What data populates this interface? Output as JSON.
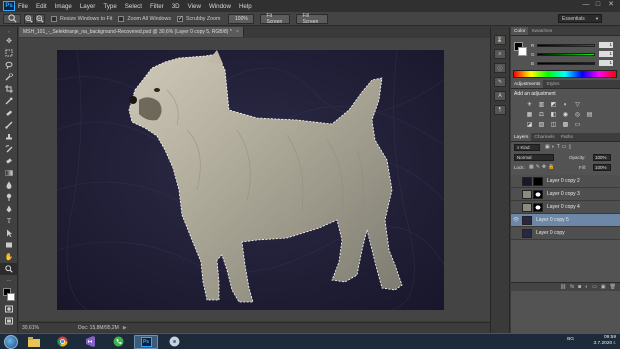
{
  "app": {
    "logo": "Ps"
  },
  "menu": [
    "File",
    "Edit",
    "Image",
    "Layer",
    "Type",
    "Select",
    "Filter",
    "3D",
    "View",
    "Window",
    "Help"
  ],
  "window_controls": {
    "minimize": "—",
    "maximize": "□",
    "close": "✕"
  },
  "options": {
    "resize_windows": "Resize Windows to Fit",
    "zoom_all": "Zoom All Windows",
    "scrubby": "Scrubby Zoom",
    "zoom_100": "100%",
    "fit_screen": "Fit Screen",
    "fill_screen": "Fill Screen",
    "workspace": "Essentials"
  },
  "document": {
    "tab_title": "MSH_101_-_Selektiranje_na_background-Recovered.psd @ 30,6% (Layer 0 copy 5, RGB/8) *",
    "close": "×"
  },
  "status": {
    "zoom": "30,61%",
    "doc": "Doc: 15,8M/95,2M"
  },
  "panels": {
    "color_tabs": [
      "Color",
      "Swatches"
    ],
    "color_values": [
      "1",
      "1",
      "1"
    ],
    "color_channels": [
      "R",
      "G",
      "B"
    ],
    "adj_tabs": [
      "Adjustments",
      "Styles"
    ],
    "adj_title": "Add an adjustment",
    "layers_tabs": [
      "Layers",
      "Channels",
      "Paths"
    ],
    "kind": "Kind",
    "blend_mode": "Normal",
    "opacity_label": "Opacity:",
    "opacity": "100%",
    "lock_label": "Lock:",
    "fill_label": "Fill:",
    "fill": "100%",
    "layers": [
      {
        "name": "Layer 0 copy 2",
        "visible": false,
        "selected": false,
        "mask": true
      },
      {
        "name": "Layer 0 copy 3",
        "visible": false,
        "selected": false,
        "mask": true
      },
      {
        "name": "Layer 0 copy 4",
        "visible": false,
        "selected": false,
        "mask": true
      },
      {
        "name": "Layer 0 copy 5",
        "visible": true,
        "selected": true,
        "mask": false
      },
      {
        "name": "Layer 0 copy",
        "visible": false,
        "selected": false,
        "mask": false
      }
    ]
  },
  "taskbar": {
    "lang": "BG",
    "time": "09:59",
    "date": "3.7.2020 г."
  }
}
